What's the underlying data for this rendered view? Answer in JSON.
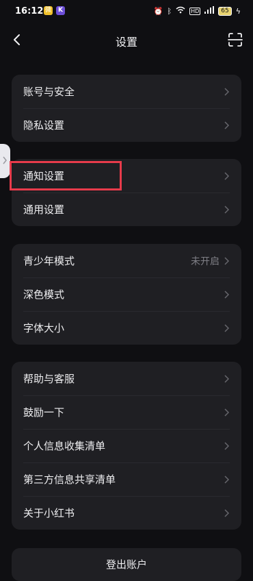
{
  "status_bar": {
    "time": "16:12",
    "app1": "微",
    "app2": "K",
    "network": "HD",
    "battery": "65"
  },
  "nav": {
    "title": "设置"
  },
  "groups": [
    {
      "items": [
        {
          "label": "账号与安全"
        },
        {
          "label": "隐私设置"
        }
      ]
    },
    {
      "items": [
        {
          "label": "通知设置"
        },
        {
          "label": "通用设置"
        }
      ]
    },
    {
      "items": [
        {
          "label": "青少年模式",
          "value": "未开启"
        },
        {
          "label": "深色模式"
        },
        {
          "label": "字体大小"
        }
      ]
    },
    {
      "items": [
        {
          "label": "帮助与客服"
        },
        {
          "label": "鼓励一下"
        },
        {
          "label": "个人信息收集清单"
        },
        {
          "label": "第三方信息共享清单"
        },
        {
          "label": "关于小红书"
        }
      ]
    }
  ],
  "logout": {
    "label": "登出账户"
  },
  "colors": {
    "background": "#0f0f12",
    "card": "#1f1f23",
    "highlight": "#e83b4b"
  },
  "icons": {
    "back": "chevron-left-icon",
    "scan": "scan-icon",
    "chevron": "chevron-right-icon"
  }
}
